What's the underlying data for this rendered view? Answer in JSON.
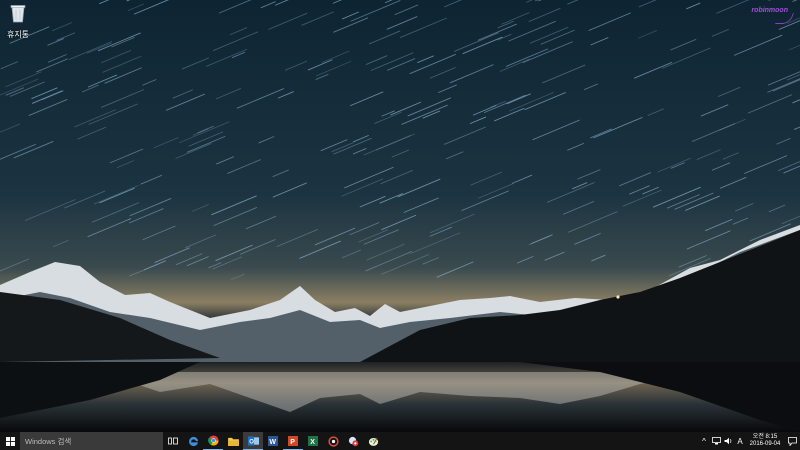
{
  "desktop": {
    "icons": [
      {
        "label": "휴지통",
        "icon": "recycle-bin-icon"
      }
    ],
    "watermark": "robinmoon"
  },
  "taskbar": {
    "search_placeholder": "Windows 검색",
    "pinned": [
      {
        "icon": "task-view-icon"
      },
      {
        "icon": "edge-icon"
      },
      {
        "icon": "chrome-icon"
      },
      {
        "icon": "file-explorer-icon"
      },
      {
        "icon": "outlook-icon"
      },
      {
        "icon": "word-icon"
      },
      {
        "icon": "powerpoint-icon"
      },
      {
        "icon": "excel-icon"
      },
      {
        "icon": "capture-app-icon"
      },
      {
        "icon": "photo-app-icon"
      },
      {
        "icon": "paint-app-icon"
      }
    ],
    "tray": {
      "chevron": "^",
      "input_method": "A",
      "time": "오전 8:15",
      "date": "2016-09-04"
    },
    "colors": {
      "taskbar": "#141414",
      "search": "#3a3a3a",
      "accent": "#7fb4e8"
    }
  }
}
